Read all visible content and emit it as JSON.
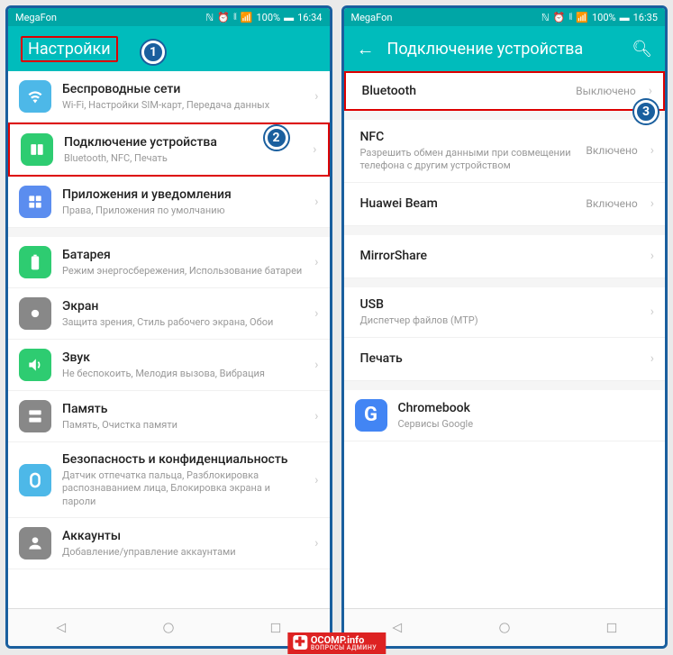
{
  "phone1": {
    "carrier": "MegaFon",
    "battery": "100%",
    "time": "16:34",
    "title": "Настройки",
    "items": [
      {
        "title": "Беспроводные сети",
        "sub": "Wi-Fi, Настройки SIM-карт, Передача данных",
        "color": "#4db8e8"
      },
      {
        "title": "Подключение устройства",
        "sub": "Bluetooth, NFC, Печать",
        "color": "#2ecc71"
      },
      {
        "title": "Приложения и уведомления",
        "sub": "Права, Приложения по умолчанию",
        "color": "#5b8def"
      },
      {
        "title": "Батарея",
        "sub": "Режим энергосбережения, Использование батареи",
        "color": "#2ecc71"
      },
      {
        "title": "Экран",
        "sub": "Защита зрения, Стиль рабочего экрана, Обои",
        "color": "#888"
      },
      {
        "title": "Звук",
        "sub": "Не беспокоить, Мелодия вызова, Вибрация",
        "color": "#2ecc71"
      },
      {
        "title": "Память",
        "sub": "Память, Очистка памяти",
        "color": "#888"
      },
      {
        "title": "Безопасность и конфиденциальность",
        "sub": "Датчик отпечатка пальца, Разблокировка распознаванием лица, Блокировка экрана и пароли",
        "color": "#4db8e8"
      },
      {
        "title": "Аккаунты",
        "sub": "Добавление/управление аккаунтами",
        "color": "#888"
      }
    ]
  },
  "phone2": {
    "carrier": "MegaFon",
    "battery": "100%",
    "time": "16:35",
    "title": "Подключение устройства",
    "items": [
      {
        "title": "Bluetooth",
        "value": "Выключено"
      },
      {
        "title": "NFC",
        "sub": "Разрешить обмен данными при совмещении телефона с другим устройством",
        "value": "Включено"
      },
      {
        "title": "Huawei Beam",
        "value": "Включено"
      },
      {
        "title": "MirrorShare"
      },
      {
        "title": "USB",
        "sub": "Диспетчер файлов (MTP)"
      },
      {
        "title": "Печать"
      },
      {
        "title": "Chromebook",
        "sub": "Сервисы Google",
        "icon": "G"
      }
    ]
  },
  "watermark": {
    "main": "OCOMP.info",
    "sub": "ВОПРОСЫ АДМИНУ"
  },
  "callouts": {
    "c1": "1",
    "c2": "2",
    "c3": "3"
  }
}
